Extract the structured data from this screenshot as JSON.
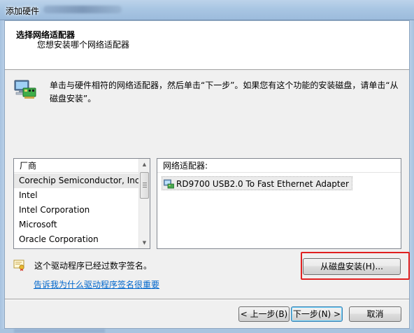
{
  "window": {
    "title": "添加硬件"
  },
  "header": {
    "title": "选择网络适配器",
    "subtitle": "您想安装哪个网络适配器"
  },
  "instruction": {
    "icon": "network-adapter-icon",
    "text": "单击与硬件相符的网络适配器，然后单击“下一步”。如果您有这个功能的安装磁盘，请单击“从磁盘安装”。"
  },
  "manufacturer_list": {
    "header": "厂商",
    "items": [
      "Corechip Semiconductor, Inc.",
      "Intel",
      "Intel Corporation",
      "Microsoft",
      "Oracle Corporation"
    ],
    "selected_index": 0
  },
  "adapter_list": {
    "header": "网络适配器:",
    "items": [
      "RD9700 USB2.0 To Fast Ethernet Adapter"
    ],
    "selected_index": 0
  },
  "signature": {
    "icon": "signed-driver-icon",
    "text": "这个驱动程序已经过数字签名。",
    "link": "告诉我为什么驱动程序签名很重要"
  },
  "buttons": {
    "have_disk": "从磁盘安装(H)...",
    "back": "< 上一步(B)",
    "next": "下一步(N) >",
    "cancel": "取消"
  },
  "colors": {
    "highlight": "#e02020",
    "link": "#0066cc"
  }
}
